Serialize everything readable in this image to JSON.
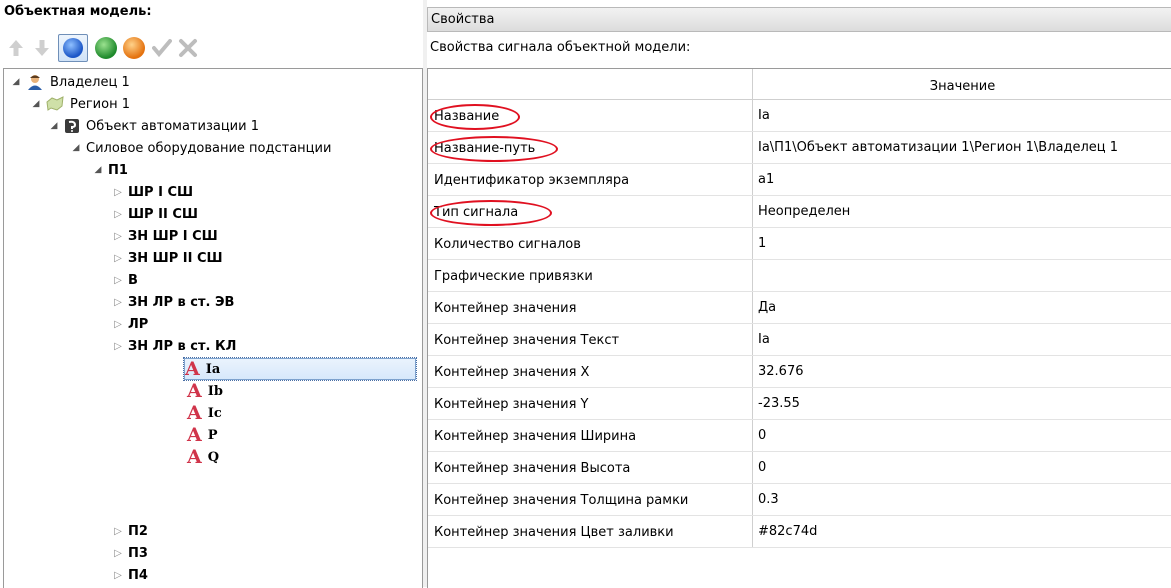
{
  "left": {
    "title": "Объектная модель:",
    "toolbar": [
      {
        "name": "move-up-icon"
      },
      {
        "name": "move-down-icon"
      },
      {
        "name": "blue-circle-icon",
        "color": "#2f6fd8"
      },
      {
        "name": "green-circle-icon",
        "color": "#2aa63a"
      },
      {
        "name": "orange-circle-icon",
        "color": "#f08a1c"
      },
      {
        "name": "check-icon"
      },
      {
        "name": "close-icon"
      }
    ],
    "tree": {
      "owner": "Владелец 1",
      "region": "Регион 1",
      "object": "Объект автоматизации 1",
      "equipment": "Силовое оборудование подстанции",
      "p1": "П1",
      "p1_children": [
        "ШР I СШ",
        "ШР II СШ",
        "ЗН ШР I СШ",
        "ЗН ШР II СШ",
        "В",
        "ЗН ЛР в ст. ЭВ",
        "ЛР",
        "ЗН ЛР в ст. КЛ"
      ],
      "signals": [
        "Ia",
        "Ib",
        "Ic",
        "P",
        "Q"
      ],
      "signal_glyph": "A",
      "selected_signal": "Ia",
      "p_more": [
        "П2",
        "П3",
        "П4"
      ]
    }
  },
  "right": {
    "header": "Свойства",
    "caption": "Свойства сигнала объектной модели:",
    "value_column": "Значение",
    "rows": [
      {
        "name": "Название",
        "value": "Ia"
      },
      {
        "name": "Название-путь",
        "value": "Ia\\П1\\Объект автоматизации 1\\Регион 1\\Владелец 1"
      },
      {
        "name": "Идентификатор экземпляра",
        "value": "a1"
      },
      {
        "name": "Тип сигнала",
        "value": "Неопределен"
      },
      {
        "name": "Количество сигналов",
        "value": "1"
      },
      {
        "name": "Графические привязки",
        "value": ""
      },
      {
        "name": "Контейнер значения",
        "value": "Да"
      },
      {
        "name": "Контейнер значения Текст",
        "value": "Ia"
      },
      {
        "name": "Контейнер значения X",
        "value": "32.676"
      },
      {
        "name": "Контейнер значения Y",
        "value": "-23.55"
      },
      {
        "name": "Контейнер значения Ширина",
        "value": "0"
      },
      {
        "name": "Контейнер значения Высота",
        "value": "0"
      },
      {
        "name": "Контейнер значения Толщина рамки",
        "value": "0.3"
      },
      {
        "name": "Контейнер значения Цвет заливки",
        "value": "#82c74d"
      }
    ]
  }
}
